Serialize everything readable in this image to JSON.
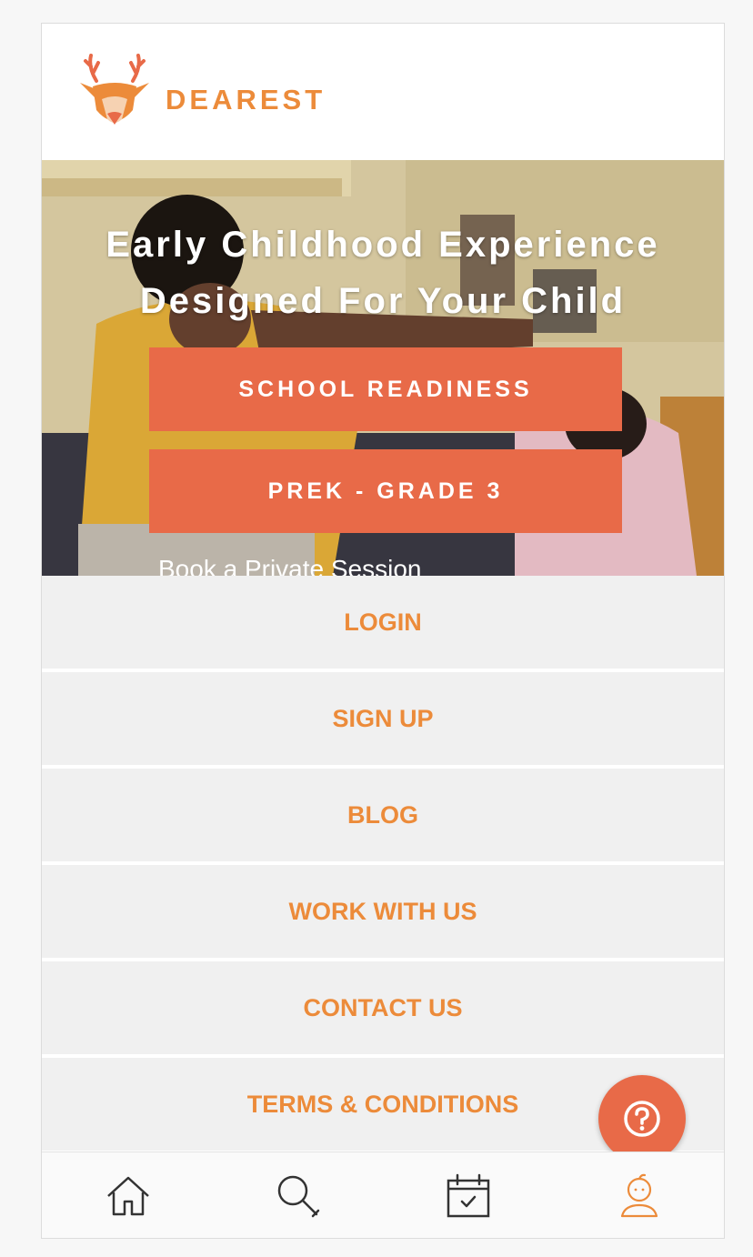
{
  "brand": {
    "name": "DEAREST",
    "logo_icon": "deer-logo-icon",
    "color": "#ec8b3a",
    "antler_color": "#e86a48"
  },
  "hero": {
    "title_line1": "Early Childhood Experience",
    "title_line2": "Designed For Your Child",
    "buttons": [
      {
        "label": "SCHOOL READINESS"
      },
      {
        "label": "PREK - GRADE 3"
      }
    ],
    "link_text": "Book a Private Session"
  },
  "menu": {
    "items": [
      {
        "label": "LOGIN"
      },
      {
        "label": "SIGN UP"
      },
      {
        "label": "BLOG"
      },
      {
        "label": "WORK WITH US"
      },
      {
        "label": "CONTACT US"
      },
      {
        "label": "TERMS & CONDITIONS"
      }
    ]
  },
  "help": {
    "icon": "question-icon"
  },
  "tabbar": {
    "tabs": [
      {
        "icon": "home-icon",
        "active": false
      },
      {
        "icon": "search-icon",
        "active": false
      },
      {
        "icon": "calendar-icon",
        "active": false
      },
      {
        "icon": "child-profile-icon",
        "active": true
      }
    ],
    "active_color": "#ec8b3a",
    "inactive_color": "#333333"
  },
  "colors": {
    "accent": "#e86a48",
    "menu_text": "#ec8b3a",
    "menu_bg": "#f0f0f0"
  }
}
